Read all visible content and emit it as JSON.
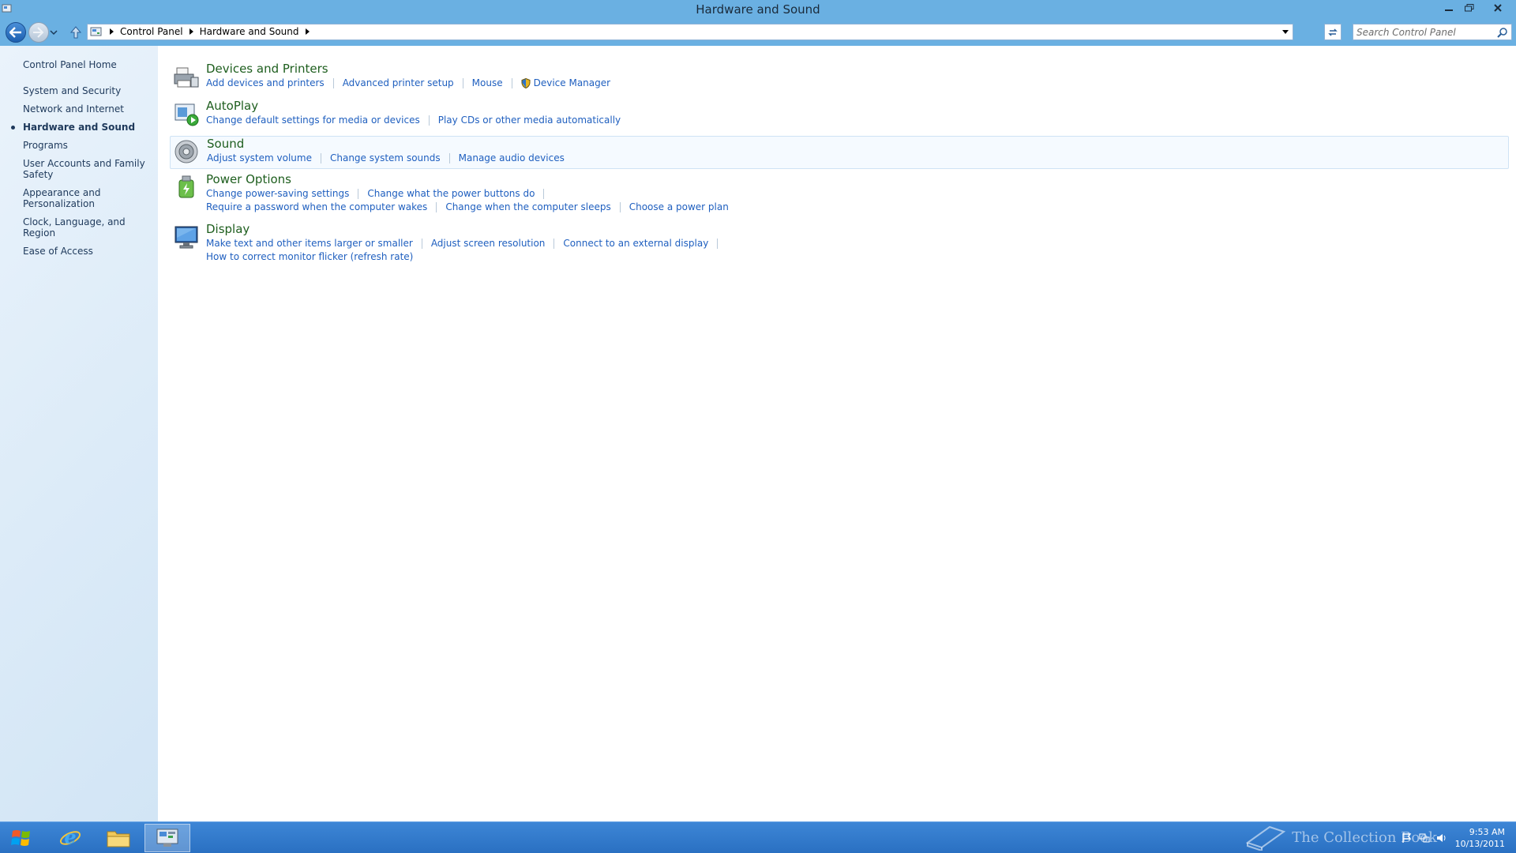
{
  "window": {
    "title": "Hardware and Sound"
  },
  "address_bar": {
    "crumbs": [
      "Control Panel",
      "Hardware and Sound"
    ],
    "search_placeholder": "Search Control Panel"
  },
  "left_pane": {
    "home": "Control Panel Home",
    "items": [
      {
        "label": "System and Security"
      },
      {
        "label": "Network and Internet"
      },
      {
        "label": "Hardware and Sound",
        "active": true
      },
      {
        "label": "Programs"
      },
      {
        "label": "User Accounts and Family Safety"
      },
      {
        "label": "Appearance and Personalization"
      },
      {
        "label": "Clock, Language, and Region"
      },
      {
        "label": "Ease of Access"
      }
    ]
  },
  "groups": {
    "devices": {
      "title": "Devices and Printers",
      "links": [
        "Add devices and printers",
        "Advanced printer setup",
        "Mouse",
        "Device Manager"
      ]
    },
    "autoplay": {
      "title": "AutoPlay",
      "links": [
        "Change default settings for media or devices",
        "Play CDs or other media automatically"
      ]
    },
    "sound": {
      "title": "Sound",
      "links": [
        "Adjust system volume",
        "Change system sounds",
        "Manage audio devices"
      ]
    },
    "power": {
      "title": "Power Options",
      "links": [
        "Change power-saving settings",
        "Change what the power buttons do",
        "Require a password when the computer wakes",
        "Change when the computer sleeps",
        "Choose a power plan"
      ]
    },
    "display": {
      "title": "Display",
      "links": [
        "Make text and other items larger or smaller",
        "Adjust screen resolution",
        "Connect to an external display",
        "How to correct monitor flicker (refresh rate)"
      ]
    }
  },
  "taskbar": {
    "apps": [
      "internet-explorer-icon",
      "file-explorer-icon",
      "control-panel-icon"
    ],
    "time": "9:53 AM",
    "date": "10/13/2011",
    "watermark": "The Collection Book"
  },
  "colors": {
    "frame": "#6ab0e2",
    "link": "#1f5fbf",
    "category_title": "#1e5e1e",
    "taskbar": "#2a70c2"
  }
}
